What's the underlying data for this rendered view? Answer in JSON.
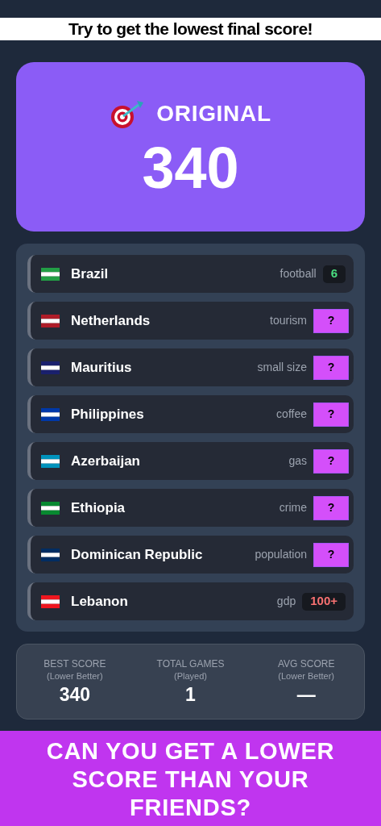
{
  "banner_top": "Try to get the lowest final score!",
  "mode_card": {
    "title": "ORIGINAL",
    "score": "340"
  },
  "rows": [
    {
      "country": "Brazil",
      "category": "football",
      "kind": "revealed",
      "value": "6",
      "color": "#4ade80",
      "flag": {
        "color": "#229e45"
      }
    },
    {
      "country": "Netherlands",
      "category": "tourism",
      "kind": "hidden",
      "value": "?",
      "flag": {
        "color": "#ae1c28"
      }
    },
    {
      "country": "Mauritius",
      "category": "small size",
      "kind": "hidden",
      "value": "?",
      "flag": {
        "color": "#1a206d"
      }
    },
    {
      "country": "Philippines",
      "category": "coffee",
      "kind": "hidden",
      "value": "?",
      "flag": {
        "color": "#0038a8"
      }
    },
    {
      "country": "Azerbaijan",
      "category": "gas",
      "kind": "hidden",
      "value": "?",
      "flag": {
        "color": "#0092bc"
      }
    },
    {
      "country": "Ethiopia",
      "category": "crime",
      "kind": "hidden",
      "value": "?",
      "flag": {
        "color": "#078930"
      }
    },
    {
      "country": "Dominican Republic",
      "category": "population",
      "kind": "hidden",
      "value": "?",
      "flag": {
        "color": "#002d62"
      }
    },
    {
      "country": "Lebanon",
      "category": "gdp",
      "kind": "revealed",
      "value": "100+",
      "color": "#f87171",
      "flag": {
        "color": "#ee161f"
      }
    }
  ],
  "stats": [
    {
      "label": "BEST SCORE",
      "note": "(Lower Better)",
      "value": "340"
    },
    {
      "label": "TOTAL GAMES",
      "note": "(Played)",
      "value": "1"
    },
    {
      "label": "AVG SCORE",
      "note": "(Lower Better)",
      "value": "—"
    }
  ],
  "banner_bottom": "CAN YOU GET A LOWER SCORE THAN YOUR FRIENDS?"
}
